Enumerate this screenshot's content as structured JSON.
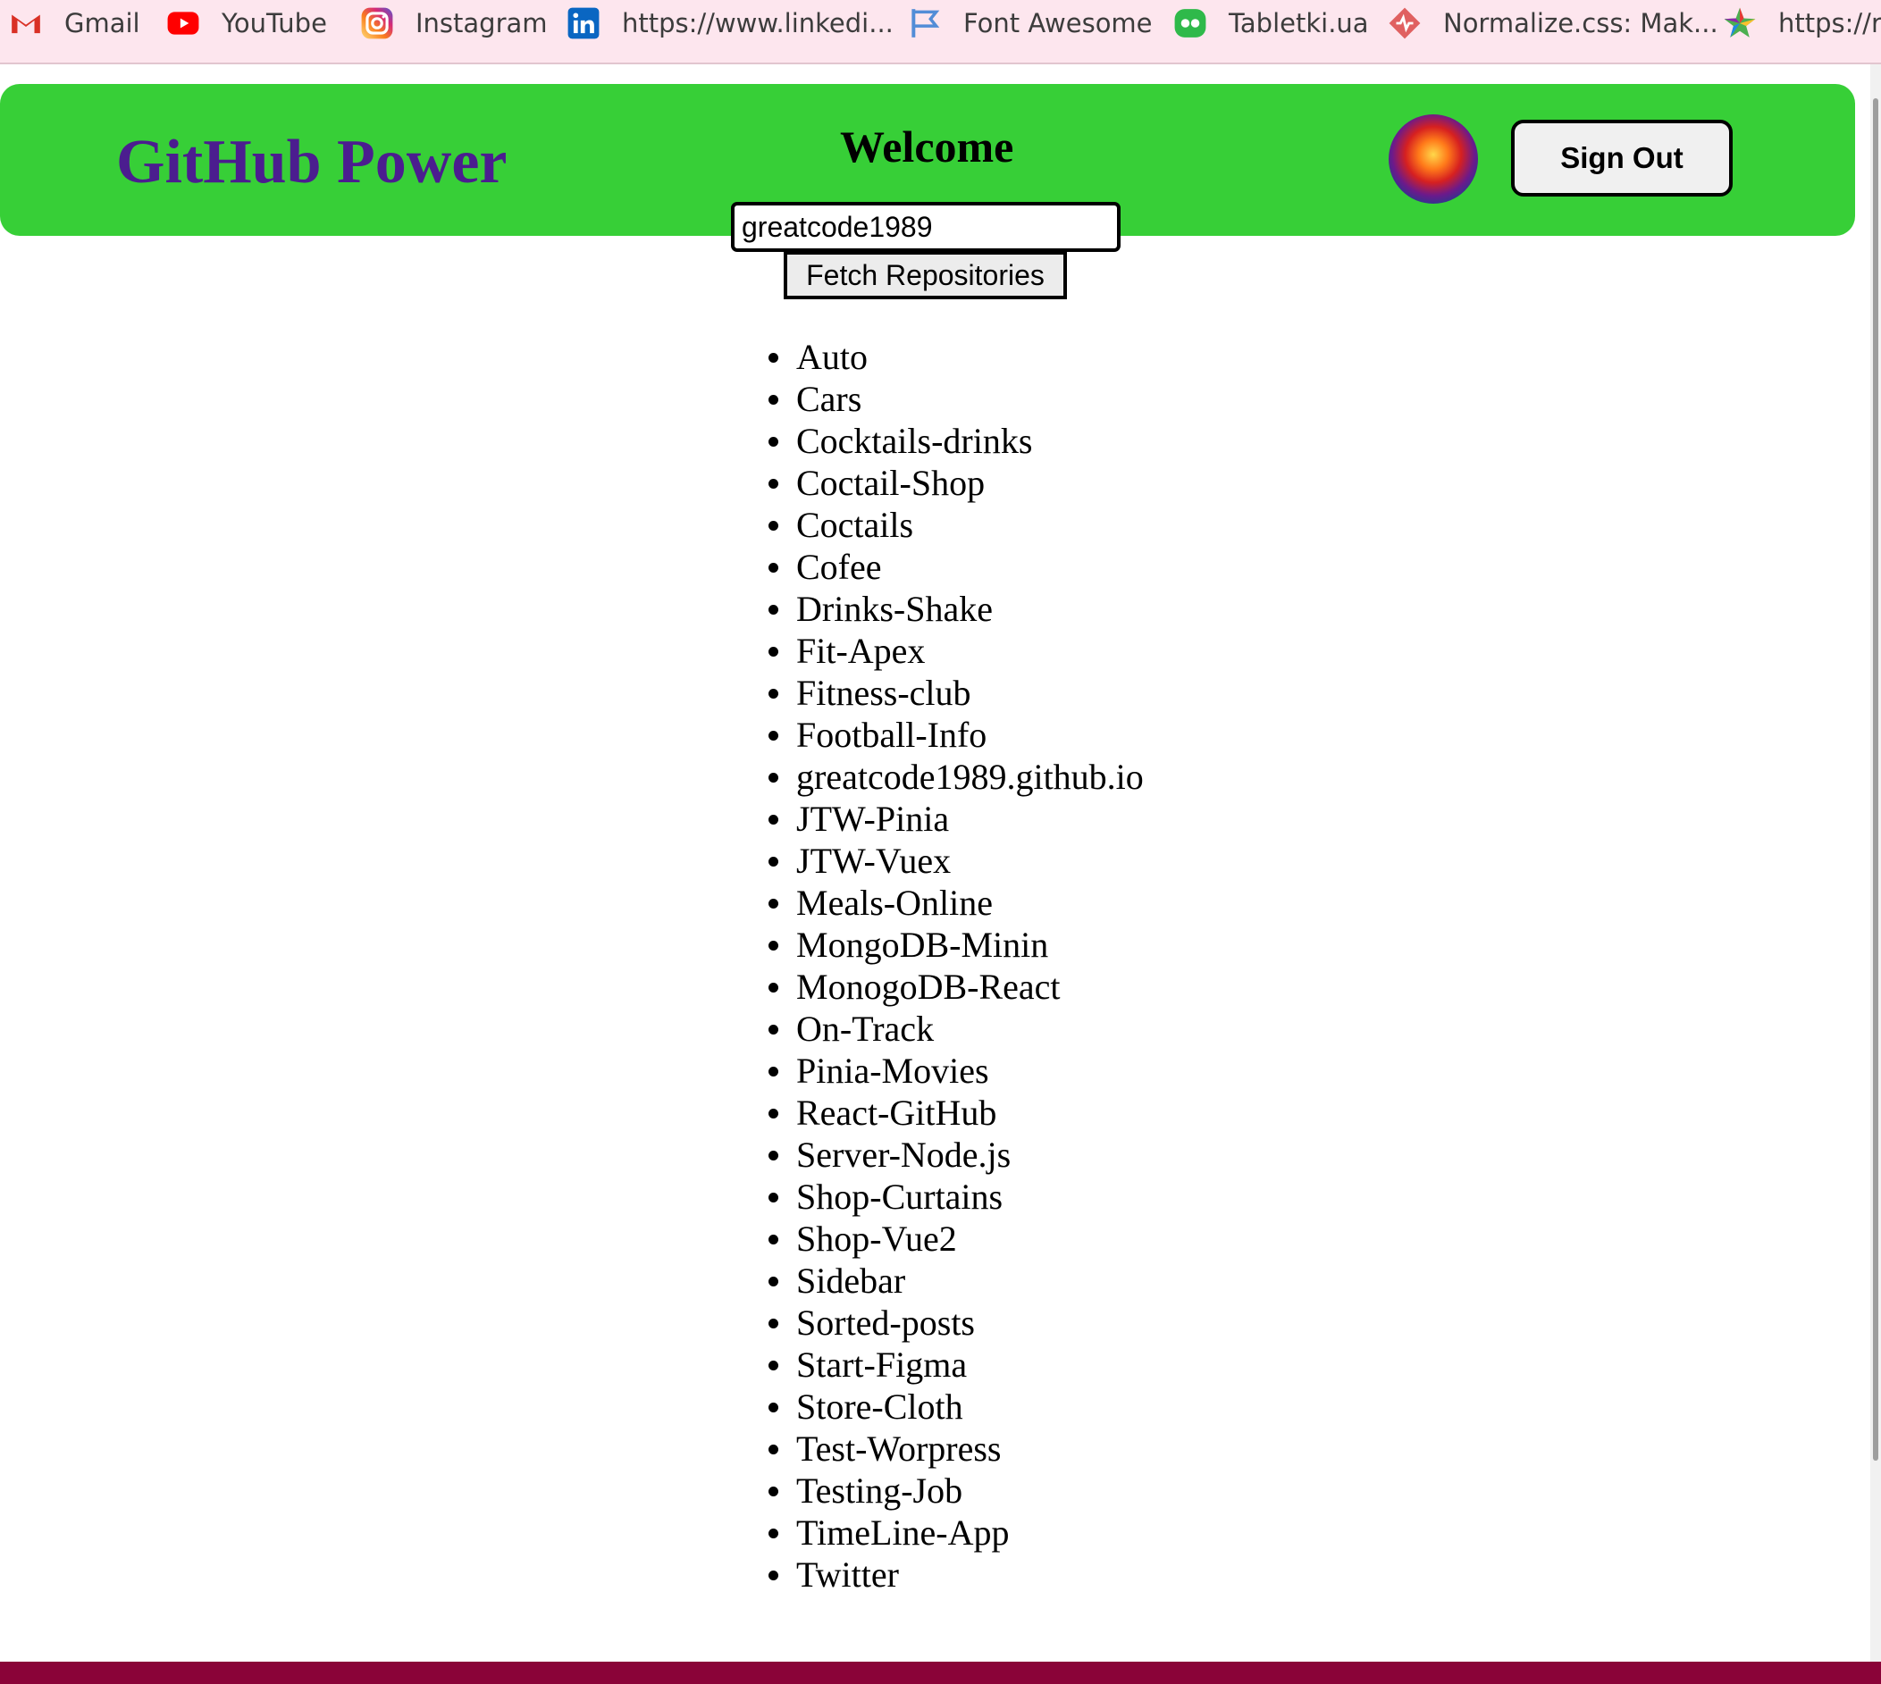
{
  "bookmarks": [
    {
      "label": "Gmail",
      "icon": "gmail-icon",
      "color": "#d93025"
    },
    {
      "label": "YouTube",
      "icon": "youtube-icon",
      "color": "#ff0000"
    },
    {
      "label": "Instagram",
      "icon": "instagram-icon",
      "color": "#d6249f"
    },
    {
      "label": "https://www.linkedi...",
      "icon": "linkedin-icon",
      "color": "#0a66c2"
    },
    {
      "label": "Font Awesome",
      "icon": "flag-icon",
      "color": "#528dd7"
    },
    {
      "label": "Tabletki.ua",
      "icon": "chat-icon",
      "color": "#2fb94a"
    },
    {
      "label": "Normalize.css: Mak...",
      "icon": "diamond-icon",
      "color": "#e06060"
    },
    {
      "label": "https://ru",
      "icon": "star-icon",
      "color": "#4caf50"
    }
  ],
  "header": {
    "brand": "GitHub Power",
    "welcome": "Welcome",
    "sign_out_label": "Sign Out",
    "background_color": "#37cf37",
    "brand_color": "#4b1d8f"
  },
  "search": {
    "value": "greatcode1989",
    "button_label": "Fetch Repositories"
  },
  "repositories": [
    "Auto",
    "Cars",
    "Cocktails-drinks",
    "Coctail-Shop",
    "Coctails",
    "Cofee",
    "Drinks-Shake",
    "Fit-Apex",
    "Fitness-club",
    "Football-Info",
    "greatcode1989.github.io",
    "JTW-Pinia",
    "JTW-Vuex",
    "Meals-Online",
    "MongoDB-Minin",
    "MonogoDB-React",
    "On-Track",
    "Pinia-Movies",
    "React-GitHub",
    "Server-Node.js",
    "Shop-Curtains",
    "Shop-Vue2",
    "Sidebar",
    "Sorted-posts",
    "Start-Figma",
    "Store-Cloth",
    "Test-Worpress",
    "Testing-Job",
    "TimeLine-App",
    "Twitter"
  ]
}
